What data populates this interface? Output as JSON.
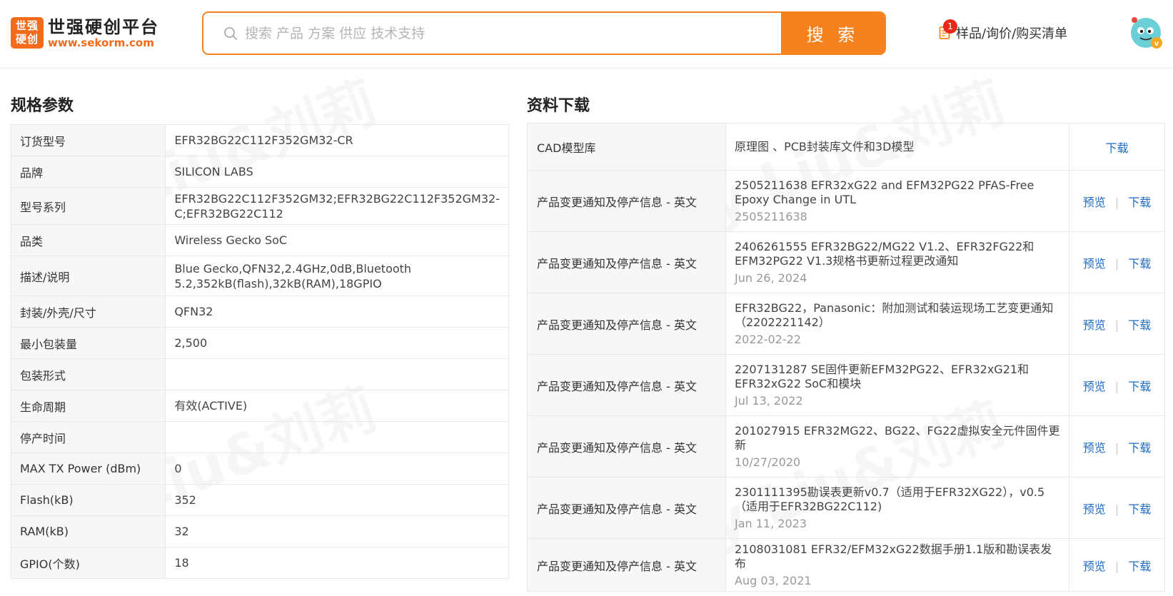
{
  "header": {
    "logo_box_line1": "世强",
    "logo_box_line2": "硬创",
    "logo_name": "世强硬创平台",
    "logo_url": "www.sekorm.com",
    "search_placeholder": "搜索 产品 方案 供应 技术支持",
    "search_button": "搜 索",
    "cart_label": "样品/询价/购买清单",
    "cart_badge": "1"
  },
  "watermark": "Lily Liu&刘莉",
  "spec": {
    "title": "规格参数",
    "rows": [
      {
        "k": "订货型号",
        "v": "EFR32BG22C112F352GM32-CR"
      },
      {
        "k": "品牌",
        "v": "SILICON LABS"
      },
      {
        "k": "型号系列",
        "v": "EFR32BG22C112F352GM32;EFR32BG22C112F352GM32-C;EFR32BG22C112"
      },
      {
        "k": "品类",
        "v": "Wireless Gecko SoC"
      },
      {
        "k": "描述/说明",
        "v": "Blue Gecko,QFN32,2.4GHz,0dB,Bluetooth 5.2,352kB(flash),32kB(RAM),18GPIO"
      },
      {
        "k": "封装/外壳/尺寸",
        "v": "QFN32"
      },
      {
        "k": "最小包装量",
        "v": "2,500"
      },
      {
        "k": "包装形式",
        "v": ""
      },
      {
        "k": "生命周期",
        "v": "有效(ACTIVE)"
      },
      {
        "k": "停产时间",
        "v": ""
      },
      {
        "k": "MAX TX Power (dBm)",
        "v": "0"
      },
      {
        "k": "Flash(kB)",
        "v": "352"
      },
      {
        "k": "RAM(kB)",
        "v": "32"
      },
      {
        "k": "GPIO(个数)",
        "v": "18"
      }
    ]
  },
  "docs": {
    "title": "资料下载",
    "preview_label": "预览",
    "download_label": "下载",
    "rows": [
      {
        "cat": "CAD模型库",
        "name": "原理图 、PCB封装库文件和3D模型",
        "sub": ""
      },
      {
        "cat": "产品变更通知及停产信息 - 英文",
        "name": "2505211638 EFR32xG22 and EFM32PG22 PFAS-Free Epoxy Change in UTL",
        "sub": "2505211638"
      },
      {
        "cat": "产品变更通知及停产信息 - 英文",
        "name": "2406261555 EFR32BG22/MG22 V1.2、EFR32FG22和EFM32PG22 V1.3规格书更新过程更改通知",
        "sub": "Jun 26, 2024"
      },
      {
        "cat": "产品变更通知及停产信息 - 英文",
        "name": "EFR32BG22，Panasonic：附加测试和装运现场工艺变更通知（2202221142）",
        "sub": "2022-02-22"
      },
      {
        "cat": "产品变更通知及停产信息 - 英文",
        "name": "2207131287 SE固件更新EFM32PG22、EFR32xG21和EFR32xG22 SoC和模块",
        "sub": "Jul 13, 2022"
      },
      {
        "cat": "产品变更通知及停产信息 - 英文",
        "name": "201027915 EFR32MG22、BG22、FG22虚拟安全元件固件更新",
        "sub": "10/27/2020"
      },
      {
        "cat": "产品变更通知及停产信息 - 英文",
        "name": "2301111395勘误表更新v0.7（适用于EFR32XG22），v0.5（适用于EFR32BG22C112)",
        "sub": "Jan 11, 2023"
      },
      {
        "cat": "产品变更通知及停产信息 - 英文",
        "name": "2108031081 EFR32/EFM32xG22数据手册1.1版和勘误表发布",
        "sub": "Aug 03, 2021"
      }
    ]
  },
  "colors": {
    "accent": "#f5821f",
    "link": "#1f6cc7",
    "badge": "#e8271b"
  }
}
